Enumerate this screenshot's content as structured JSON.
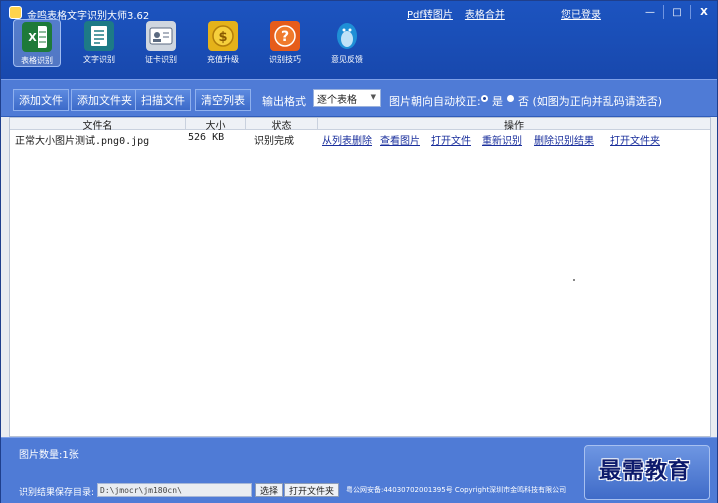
{
  "window": {
    "title": "金鸣表格文字识别大师3.62",
    "links": [
      "Pdf转图片",
      "表格合并"
    ],
    "login": "您已登录",
    "controls": [
      "—",
      "□",
      "X"
    ]
  },
  "toolbar": [
    {
      "label": "表格识别",
      "icon": "excel-icon",
      "color": "#1e7a3a",
      "active": true
    },
    {
      "label": "文字识别",
      "icon": "text-doc-icon",
      "color": "#1d7a86"
    },
    {
      "label": "证卡识别",
      "icon": "id-card-icon",
      "color": "#cfd6df"
    },
    {
      "label": "充值升级",
      "icon": "coin-icon",
      "color": "#e5b21a"
    },
    {
      "label": "识别技巧",
      "icon": "help-icon",
      "color": "#e65c1a"
    },
    {
      "label": "意见反馈",
      "icon": "qq-penguin-icon",
      "color": "#1f8fd6"
    }
  ],
  "actionbar": {
    "buttons": [
      "添加文件",
      "添加文件夹",
      "扫描文件",
      "清空列表"
    ],
    "output_label": "输出格式",
    "output_value": "逐个表格",
    "orient_label": "图片朝向自动校正:",
    "opt_yes": "是",
    "opt_no": "否 (如图为正向并乱码请选否)"
  },
  "table": {
    "headers": [
      "文件名",
      "大小",
      "状态",
      "操作"
    ],
    "rows": [
      {
        "filename": "正常大小图片测试.png0.jpg",
        "size": "526 KB",
        "status": "识别完成",
        "ops": [
          "从列表删除",
          "查看图片",
          "打开文件",
          "重新识别",
          "删除识别结果",
          "打开文件夹"
        ]
      }
    ]
  },
  "footer": {
    "count": "图片数量:1张",
    "path_label": "识别结果保存目录:",
    "path_value": "D:\\jmocr\\jm180cn\\",
    "choose": "选择",
    "open_folder": "打开文件夹",
    "copyright": "粤公网安备:44030702001395号 Copyright深圳市金鸣科技有限公司"
  },
  "watermark": "最需教育"
}
